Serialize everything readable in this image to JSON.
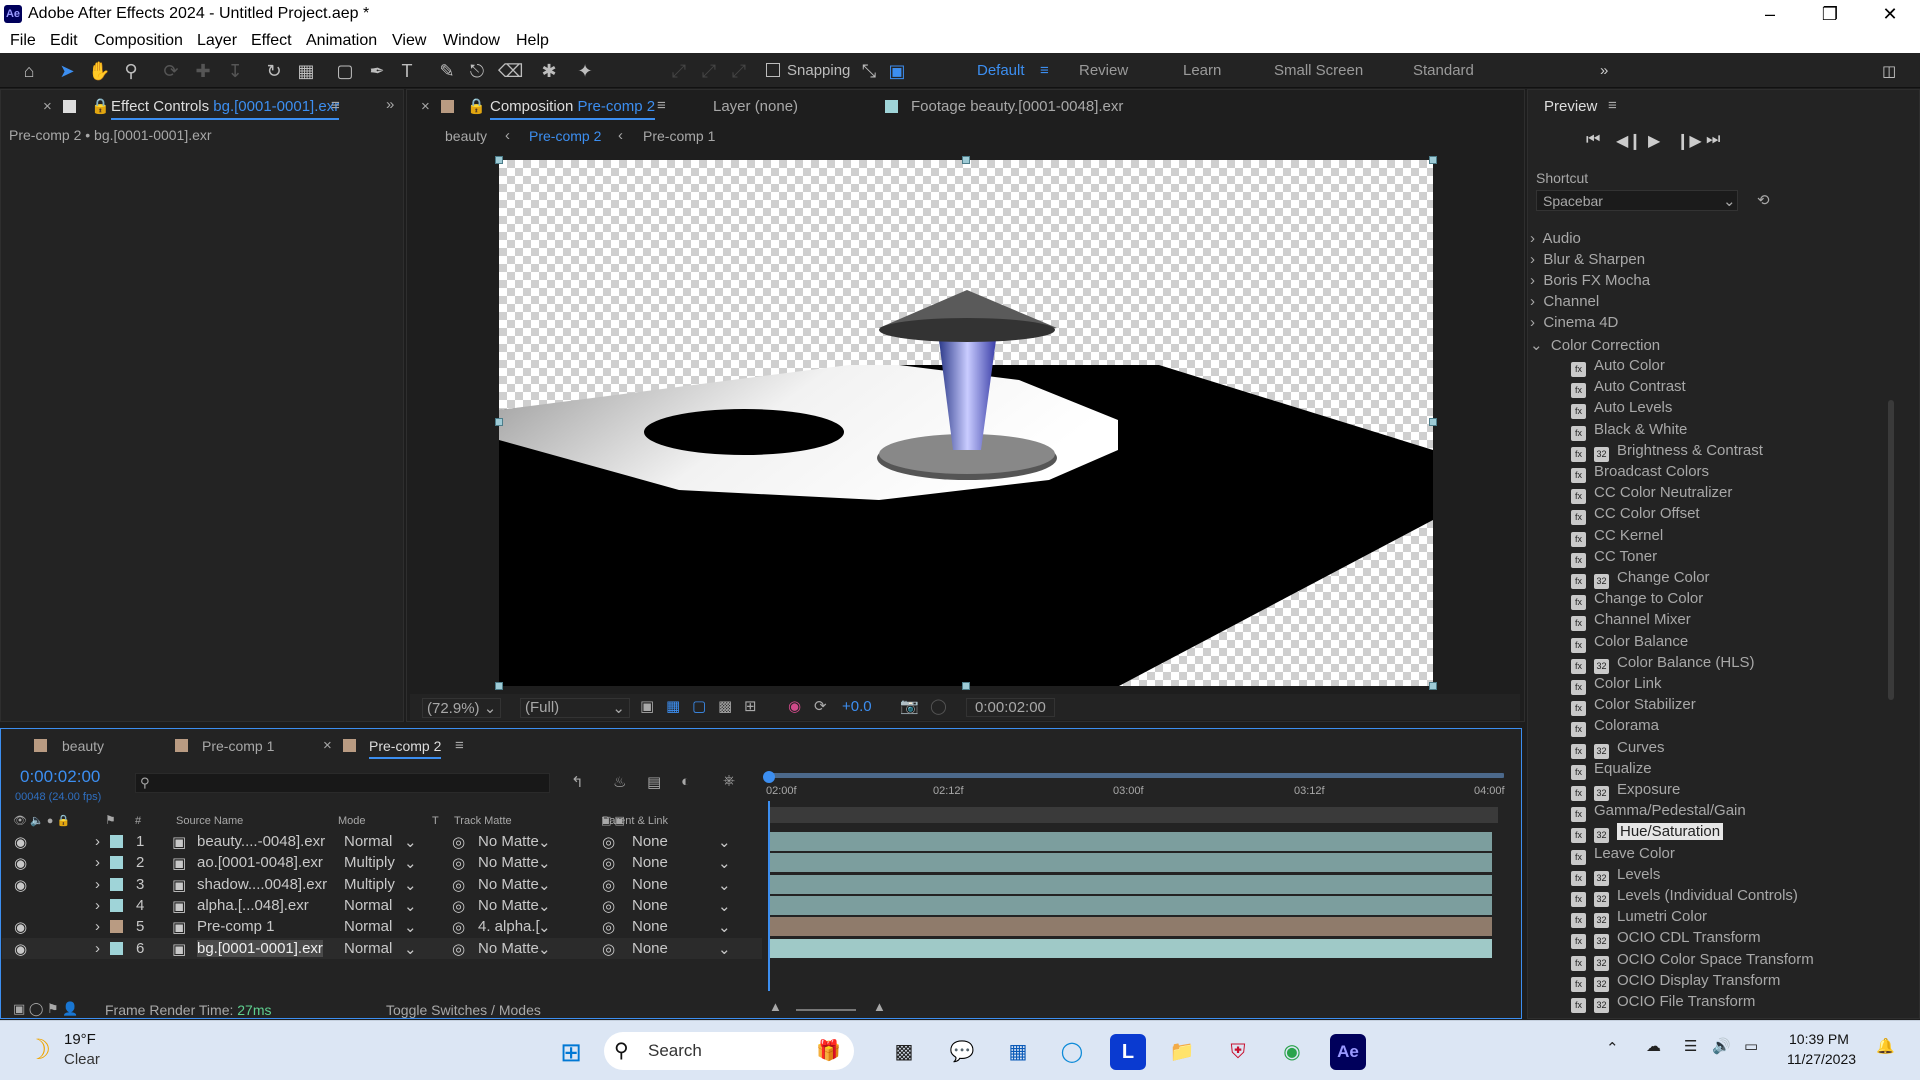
{
  "window": {
    "title": "Adobe After Effects 2024 - Untitled Project.aep *",
    "app_icon": "Ae"
  },
  "menu": [
    "File",
    "Edit",
    "Composition",
    "Layer",
    "Effect",
    "Animation",
    "View",
    "Window",
    "Help"
  ],
  "toolbar": {
    "snapping": "Snapping",
    "workspaces": [
      "Default",
      "Review",
      "Learn",
      "Small Screen",
      "Standard"
    ]
  },
  "effect_controls": {
    "tab_label": "Effect Controls",
    "tab_item": "bg.[0001-0001].exr",
    "breadcrumb": "Pre-comp 2 • bg.[0001-0001].exr"
  },
  "viewer": {
    "comp_tab_label": "Composition",
    "comp_tab_item": "Pre-comp 2",
    "layer_tab": "Layer  (none)",
    "footage_tab_label": "Footage",
    "footage_tab_item": "beauty.[0001-0048].exr",
    "crumbs": [
      "beauty",
      "Pre-comp 2",
      "Pre-comp 1"
    ],
    "zoom": "(72.9%)",
    "resolution": "(Full)",
    "exposure": "+0.0",
    "timecode": "0:00:02:00"
  },
  "preview": {
    "title": "Preview",
    "shortcut_label": "Shortcut",
    "shortcut_value": "Spacebar"
  },
  "effects": {
    "categories": [
      "Audio",
      "Blur & Sharpen",
      "Boris FX Mocha",
      "Channel",
      "Cinema 4D"
    ],
    "open_category": "Color Correction",
    "items": [
      {
        "name": "Auto Color",
        "badge": false
      },
      {
        "name": "Auto Contrast",
        "badge": false
      },
      {
        "name": "Auto Levels",
        "badge": false
      },
      {
        "name": "Black & White",
        "badge": false
      },
      {
        "name": "Brightness & Contrast",
        "badge": true
      },
      {
        "name": "Broadcast Colors",
        "badge": false
      },
      {
        "name": "CC Color Neutralizer",
        "badge": false
      },
      {
        "name": "CC Color Offset",
        "badge": false
      },
      {
        "name": "CC Kernel",
        "badge": false
      },
      {
        "name": "CC Toner",
        "badge": false
      },
      {
        "name": "Change Color",
        "badge": true
      },
      {
        "name": "Change to Color",
        "badge": false
      },
      {
        "name": "Channel Mixer",
        "badge": false
      },
      {
        "name": "Color Balance",
        "badge": false
      },
      {
        "name": "Color Balance (HLS)",
        "badge": true
      },
      {
        "name": "Color Link",
        "badge": false
      },
      {
        "name": "Color Stabilizer",
        "badge": false
      },
      {
        "name": "Colorama",
        "badge": false
      },
      {
        "name": "Curves",
        "badge": true
      },
      {
        "name": "Equalize",
        "badge": false
      },
      {
        "name": "Exposure",
        "badge": true
      },
      {
        "name": "Gamma/Pedestal/Gain",
        "badge": false
      },
      {
        "name": "Hue/Saturation",
        "badge": true
      },
      {
        "name": "Leave Color",
        "badge": false
      },
      {
        "name": "Levels",
        "badge": true
      },
      {
        "name": "Levels (Individual Controls)",
        "badge": true
      },
      {
        "name": "Lumetri Color",
        "badge": true
      },
      {
        "name": "OCIO CDL Transform",
        "badge": true
      },
      {
        "name": "OCIO Color Space Transform",
        "badge": true
      },
      {
        "name": "OCIO Display Transform",
        "badge": true
      },
      {
        "name": "OCIO File Transform",
        "badge": true
      }
    ],
    "selected": "Hue/Saturation"
  },
  "timeline": {
    "tabs": [
      "beauty",
      "Pre-comp 1",
      "Pre-comp 2"
    ],
    "timecode": "0:00:02:00",
    "fps": "00048 (24.00 fps)",
    "columns": {
      "num": "#",
      "source": "Source Name",
      "mode": "Mode",
      "t": "T",
      "matte": "Track Matte",
      "parent": "Parent & Link"
    },
    "ruler": [
      "02:00f",
      "02:12f",
      "03:00f",
      "03:12f",
      "04:00f"
    ],
    "layers": [
      {
        "num": "1",
        "name": "beauty....-0048].exr",
        "mode": "Normal",
        "matte": "No Matte",
        "parent": "None",
        "color": "#9fd4d8",
        "bar": "#7c9e9e",
        "eye": true
      },
      {
        "num": "2",
        "name": "ao.[0001-0048].exr",
        "mode": "Multiply",
        "matte": "No Matte",
        "parent": "None",
        "color": "#9fd4d8",
        "bar": "#7c9e9e",
        "eye": true
      },
      {
        "num": "3",
        "name": "shadow....0048].exr",
        "mode": "Multiply",
        "matte": "No Matte",
        "parent": "None",
        "color": "#9fd4d8",
        "bar": "#7c9e9e",
        "eye": true
      },
      {
        "num": "4",
        "name": "alpha.[...048].exr",
        "mode": "Normal",
        "matte": "No Matte",
        "parent": "None",
        "color": "#9fd4d8",
        "bar": "#7c9e9e",
        "eye": false
      },
      {
        "num": "5",
        "name": "Pre-comp 1",
        "mode": "Normal",
        "matte": "4. alpha.[",
        "parent": "None",
        "color": "#b99b82",
        "bar": "#8f7b6b",
        "eye": true
      },
      {
        "num": "6",
        "name": "bg.[0001-0001].exr",
        "mode": "Normal",
        "matte": "No Matte",
        "parent": "None",
        "color": "#9fd4d8",
        "bar": "#9fc9c7",
        "eye": true
      }
    ],
    "render_label": "Frame Render Time:",
    "render_value": "27ms",
    "toggle": "Toggle Switches / Modes"
  },
  "taskbar": {
    "weather_temp": "19°F",
    "weather_desc": "Clear",
    "search": "Search",
    "time": "10:39 PM",
    "date": "11/27/2023"
  }
}
